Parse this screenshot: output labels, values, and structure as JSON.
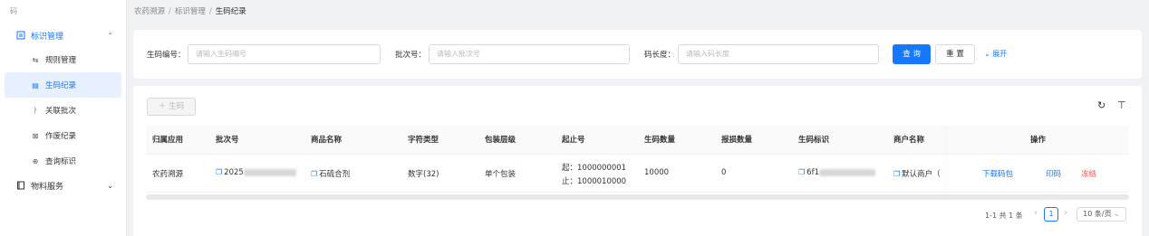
{
  "sidebar": {
    "top_label": "码",
    "group1": {
      "label": "标识管理",
      "chevron": "⌃"
    },
    "items": [
      {
        "label": "规则管理",
        "icon": "rules-icon",
        "glyph": "⇆"
      },
      {
        "label": "生码纪录",
        "icon": "record-icon",
        "glyph": "▤"
      },
      {
        "label": "关联批次",
        "icon": "link-icon",
        "glyph": "ᚹ"
      },
      {
        "label": "作废纪录",
        "icon": "void-icon",
        "glyph": "⊠"
      },
      {
        "label": "查询标识",
        "icon": "search-icon",
        "glyph": "⊕"
      }
    ],
    "group2": {
      "label": "物料服务",
      "chevron": "⌄"
    }
  },
  "breadcrumb": {
    "items": [
      "农药溯源",
      "标识管理",
      "生码纪录"
    ]
  },
  "search": {
    "fields": [
      {
        "label": "生码编号：",
        "placeholder": "请输入生码编号"
      },
      {
        "label": "批次号：",
        "placeholder": "请输入批次号"
      },
      {
        "label": "码长度：",
        "placeholder": "请输入码长度"
      }
    ],
    "query_label": "查 询",
    "reset_label": "重 置",
    "expand_label": "展开"
  },
  "toolbar": {
    "generate_label": "＋ 生码"
  },
  "table": {
    "columns": [
      "归属应用",
      "批次号",
      "商品名称",
      "字符类型",
      "包装层级",
      "起止号",
      "生码数量",
      "报损数量",
      "生码标识",
      "商户名称",
      "操作"
    ],
    "rows": [
      {
        "app": "农药溯源",
        "batch": "2025",
        "product": "石硫合剂",
        "char_type": "数字(32)",
        "pack_level": "单个包装",
        "start": "起：1000000001",
        "end": "止：1000010000",
        "gen_count": "10000",
        "loss_count": "0",
        "code_id": "6f1",
        "merchant": "默认商户（",
        "actions": [
          "下载码包",
          "印码",
          "冻结"
        ]
      }
    ]
  },
  "pagination": {
    "summary": "1-1 共 1 条",
    "prev": "‹",
    "page": "1",
    "next": "›",
    "page_size": "10 条/页",
    "size_chevron": "⌄"
  },
  "colors": {
    "primary": "#1677ff",
    "danger": "#ff4d4f"
  }
}
